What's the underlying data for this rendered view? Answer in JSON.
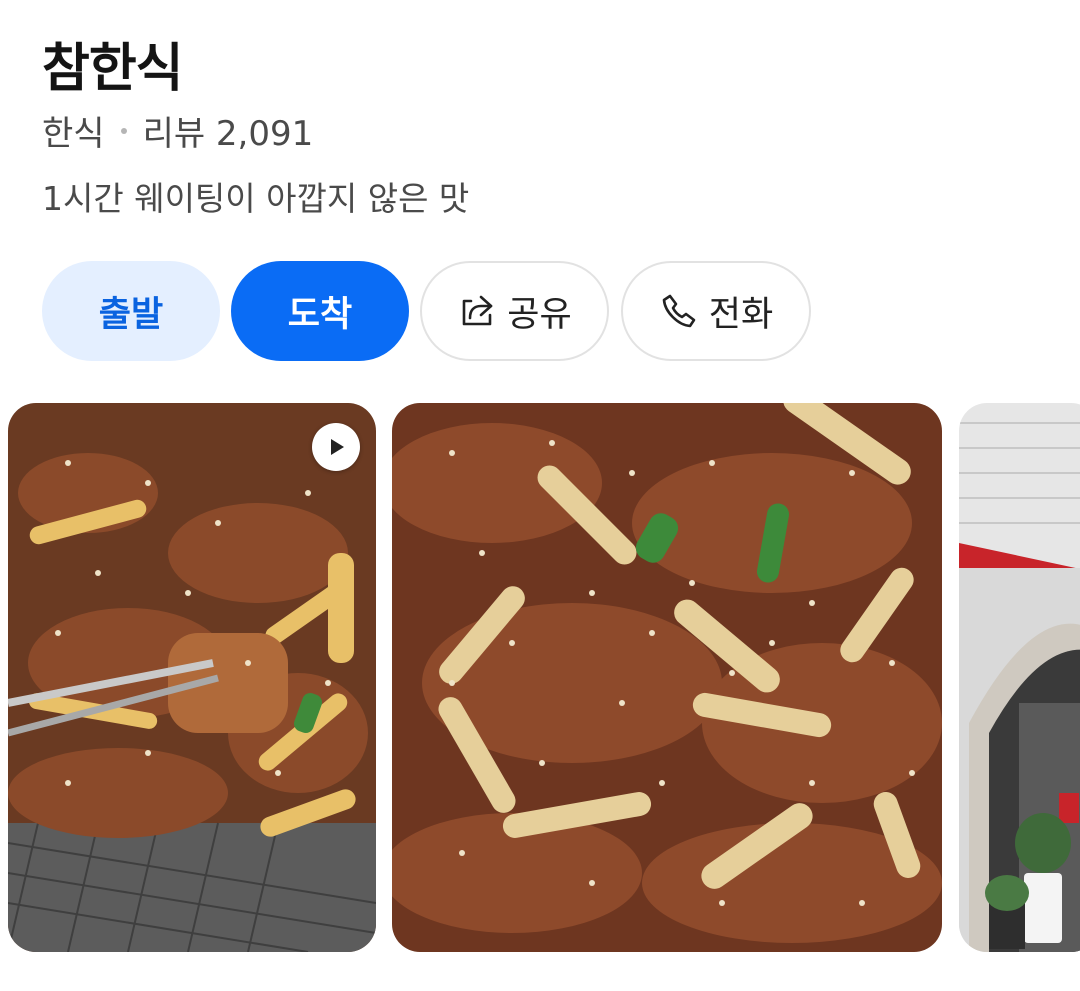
{
  "place": {
    "name": "참한식",
    "category": "한식",
    "review_label": "리뷰 2,091",
    "tagline": "1시간 웨이팅이 아깝지 않은 맛"
  },
  "actions": {
    "depart_label": "출발",
    "arrive_label": "도착",
    "share_label": "공유",
    "call_label": "전화"
  },
  "photos": [
    {
      "icon": "play-icon",
      "kind": "video"
    },
    {
      "kind": "image"
    },
    {
      "kind": "image"
    }
  ],
  "colors": {
    "accent": "#0a6cf5",
    "accent_light": "#e4efff",
    "text_primary": "#141414",
    "text_secondary": "#4a4a4a"
  }
}
